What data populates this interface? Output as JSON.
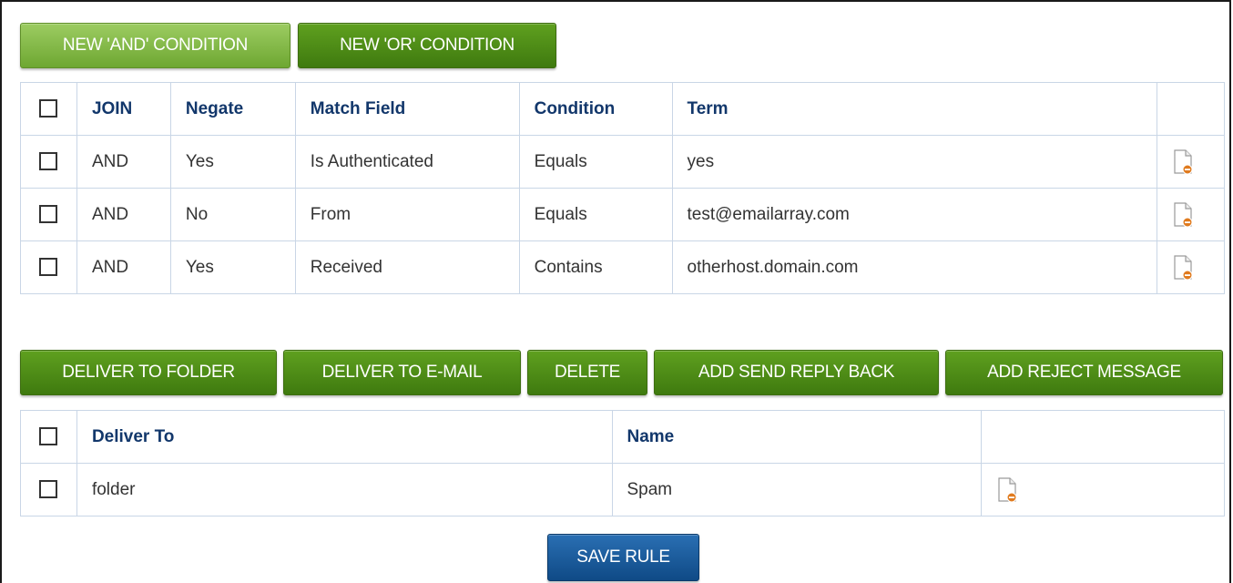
{
  "condition_buttons": {
    "new_and": "NEW 'AND' CONDITION",
    "new_or": "NEW 'OR' CONDITION"
  },
  "conditions_table": {
    "headers": {
      "join": "JOIN",
      "negate": "Negate",
      "match_field": "Match Field",
      "condition": "Condition",
      "term": "Term"
    },
    "rows": [
      {
        "join": "AND",
        "negate": "Yes",
        "match_field": "Is Authenticated",
        "condition": "Equals",
        "term": "yes",
        "icon": "delete-document-icon"
      },
      {
        "join": "AND",
        "negate": "No",
        "match_field": "From",
        "condition": "Equals",
        "term": "test@emailarray.com",
        "icon": "delete-document-icon"
      },
      {
        "join": "AND",
        "negate": "Yes",
        "match_field": "Received",
        "condition": "Contains",
        "term": "otherhost.domain.com",
        "icon": "delete-document-icon"
      }
    ]
  },
  "action_buttons": {
    "deliver_to_folder": "DELIVER TO FOLDER",
    "deliver_to_email": "DELIVER TO E-MAIL",
    "delete": "DELETE",
    "add_send_reply_back": "ADD SEND REPLY BACK",
    "add_reject_message": "ADD REJECT MESSAGE"
  },
  "actions_table": {
    "headers": {
      "deliver_to": "Deliver To",
      "name": "Name"
    },
    "rows": [
      {
        "deliver_to": "folder",
        "name": "Spam",
        "icon": "delete-document-icon"
      }
    ]
  },
  "save_button": "SAVE RULE",
  "colors": {
    "green_button": "#4a8a16",
    "green_button_light": "#86ba4a",
    "blue_button": "#1a5c9e",
    "header_text": "#12376b",
    "table_border": "#c9d6e6"
  }
}
